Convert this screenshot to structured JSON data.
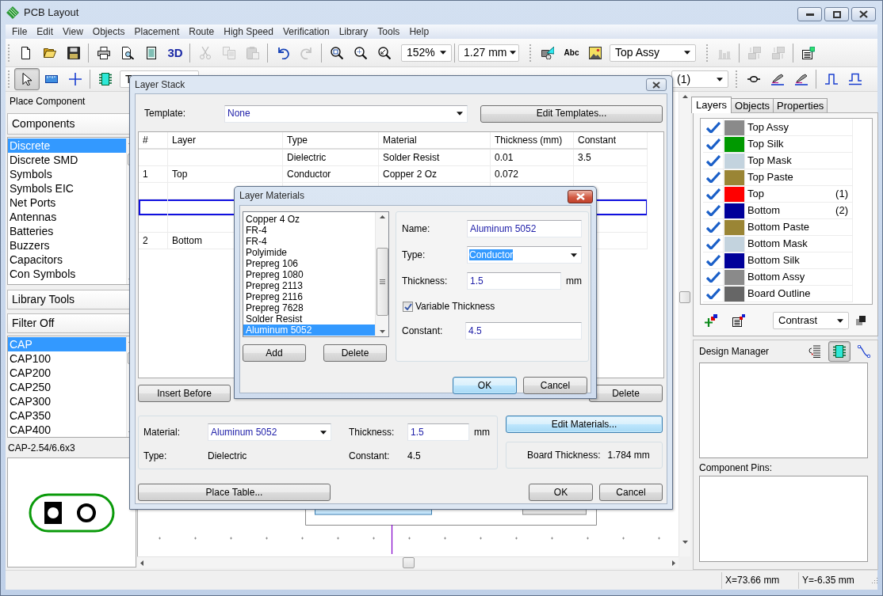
{
  "window": {
    "title": "PCB Layout"
  },
  "menu": [
    "File",
    "Edit",
    "View",
    "Objects",
    "Placement",
    "Route",
    "High Speed",
    "Verification",
    "Library",
    "Tools",
    "Help"
  ],
  "toolbar_row_1": [
    {
      "groups": [
        [
          {
            "kind": "button",
            "disabled": false
          },
          {
            "kind": "button",
            "disabled": false
          },
          {
            "kind": "button",
            "disabled": false
          }
        ],
        [
          {
            "kind": "button",
            "disabled": false
          },
          {
            "kind": "button",
            "disabled": false
          },
          {
            "kind": "button",
            "disabled": false
          },
          {
            "kind": "text_button",
            "label": "3D",
            "disabled": false
          }
        ],
        [
          {
            "kind": "button",
            "disabled": true
          },
          {
            "kind": "button",
            "disabled": true
          },
          {
            "kind": "button",
            "disabled": true
          }
        ],
        [
          {
            "kind": "button",
            "disabled": false
          },
          {
            "kind": "button",
            "disabled": true
          }
        ],
        [
          {
            "kind": "button",
            "disabled": false
          },
          {
            "kind": "button",
            "disabled": false
          },
          {
            "kind": "button",
            "disabled": false
          },
          {
            "kind": "combo",
            "value": "152%"
          }
        ],
        [
          {
            "kind": "combo",
            "value": "1.27 mm"
          }
        ]
      ]
    },
    {
      "groups": [
        [
          {
            "kind": "button",
            "disabled": false
          },
          {
            "kind": "text_button",
            "label": "Abc",
            "disabled": false
          },
          {
            "kind": "button",
            "disabled": false
          },
          {
            "kind": "combo",
            "value": "Top Assy"
          }
        ]
      ]
    },
    {
      "groups": [
        [
          {
            "kind": "button",
            "disabled": true
          }
        ],
        [
          {
            "kind": "button",
            "disabled": true
          },
          {
            "kind": "button",
            "disabled": true
          }
        ],
        [
          {
            "kind": "button",
            "disabled": false
          }
        ]
      ]
    }
  ],
  "toolbar_row_2": [
    {
      "groups": [
        [
          {
            "kind": "button",
            "pressed": true
          },
          {
            "kind": "button",
            "pressed": false
          },
          {
            "kind": "button",
            "pressed": false
          }
        ],
        [
          {
            "kind": "button",
            "pressed": false
          },
          {
            "kind": "combo",
            "value": "T"
          }
        ]
      ]
    },
    {
      "groups": [
        [
          {
            "kind": "combo",
            "value": "(1)"
          }
        ]
      ]
    },
    {
      "groups": [
        [
          {
            "kind": "button",
            "pressed": false
          },
          {
            "kind": "button",
            "pressed": false
          },
          {
            "kind": "button",
            "pressed": false
          }
        ],
        [
          {
            "kind": "button",
            "pressed": false
          },
          {
            "kind": "button",
            "pressed": false
          }
        ]
      ]
    }
  ],
  "place_component": {
    "title": "Place Component",
    "components_button": "Components",
    "categories": [
      {
        "label": "Discrete",
        "selected": true
      },
      {
        "label": "Discrete SMD",
        "selected": false
      },
      {
        "label": "Symbols",
        "selected": false
      },
      {
        "label": "Symbols EIC",
        "selected": false
      },
      {
        "label": "Net Ports",
        "selected": false
      },
      {
        "label": "Antennas",
        "selected": false
      },
      {
        "label": "Batteries",
        "selected": false
      },
      {
        "label": "Buzzers",
        "selected": false
      },
      {
        "label": "Capacitors",
        "selected": false
      },
      {
        "label": "Con Symbols",
        "selected": false
      }
    ],
    "library_tools_button": "Library Tools",
    "filter_button": "Filter Off",
    "parts": [
      {
        "label": "CAP",
        "selected": true
      },
      {
        "label": "CAP100",
        "selected": false
      },
      {
        "label": "CAP200",
        "selected": false
      },
      {
        "label": "CAP250",
        "selected": false
      },
      {
        "label": "CAP300",
        "selected": false
      },
      {
        "label": "CAP350",
        "selected": false
      },
      {
        "label": "CAP400",
        "selected": false
      }
    ],
    "footprint": "CAP-2.54/6.6x3"
  },
  "layers_panel": {
    "tabs": [
      {
        "label": "Layers",
        "selected": true
      },
      {
        "label": "Objects",
        "selected": false
      },
      {
        "label": "Properties",
        "selected": false
      }
    ],
    "layers": [
      {
        "name": "Top Assy",
        "visible": true,
        "color": "#8a8a8a"
      },
      {
        "name": "Top Silk",
        "visible": true,
        "color": "#009900"
      },
      {
        "name": "Top Mask",
        "visible": true,
        "color": "#c3d3de"
      },
      {
        "name": "Top Paste",
        "visible": true,
        "color": "#9a8535"
      },
      {
        "name": "Top",
        "number": "(1)",
        "visible": true,
        "color": "#ff0000"
      },
      {
        "name": "Bottom",
        "number": "(2)",
        "visible": true,
        "color": "#00009a"
      },
      {
        "name": "Bottom Paste",
        "visible": true,
        "color": "#9a8535"
      },
      {
        "name": "Bottom Mask",
        "visible": true,
        "color": "#c3d3de"
      },
      {
        "name": "Bottom Silk",
        "visible": true,
        "color": "#00009a"
      },
      {
        "name": "Bottom Assy",
        "visible": true,
        "color": "#8a8a8a"
      },
      {
        "name": "Board Outline",
        "visible": true,
        "color": "#666666"
      }
    ],
    "display_mode": "Contrast"
  },
  "design_manager": {
    "title": "Design Manager",
    "views": [
      {
        "pressed": false
      },
      {
        "pressed": true
      },
      {
        "pressed": false
      }
    ],
    "pins_label": "Component Pins:"
  },
  "status_bar": {
    "x": "X=73.66 mm",
    "y": "Y=-6.35 mm"
  },
  "layer_stack": {
    "title": "Layer Stack",
    "template_label": "Template:",
    "template": "None",
    "edit_templates_button": "Edit Templates...",
    "table": {
      "columns": [
        "#",
        "Layer",
        "Type",
        "Material",
        "Thickness (mm)",
        "Constant"
      ],
      "rows": [
        {
          "selected": false,
          "type": "Dielectric",
          "material": "Solder Resist",
          "thickness": "0.01",
          "constant": "3.5"
        },
        {
          "selected": false,
          "number": "1",
          "layer": "Top",
          "type": "Conductor",
          "material": "Copper 2 Oz",
          "thickness": "0.072"
        },
        {
          "selected": false
        },
        {
          "selected": true
        },
        {
          "selected": false
        },
        {
          "selected": false,
          "number": "2",
          "layer": "Bottom"
        }
      ]
    },
    "insert_before_button": "Insert Before",
    "delete_button": "Delete",
    "material_label": "Material:",
    "material": "Aluminum 5052",
    "thickness_label": "Thickness:",
    "thickness": "1.5",
    "thickness_unit": "mm",
    "type_label": "Type:",
    "type": "Dielectric",
    "constant_label": "Constant:",
    "constant": "4.5",
    "edit_materials_button": {
      "label": "Edit Materials...",
      "focused": true
    },
    "board_thickness_label": "Board Thickness:",
    "board_thickness": "1.784 mm",
    "buttons": [
      {
        "label": "Place Table...",
        "focused": false
      },
      {
        "label": "OK",
        "focused": false
      },
      {
        "label": "Cancel",
        "focused": false
      }
    ]
  },
  "layer_materials": {
    "title": "Layer Materials",
    "materials": [
      {
        "label": "Copper 4 Oz",
        "selected": false
      },
      {
        "label": "FR-4",
        "selected": false
      },
      {
        "label": "FR-4",
        "selected": false
      },
      {
        "label": "Polyimide",
        "selected": false
      },
      {
        "label": "Prepreg 106",
        "selected": false
      },
      {
        "label": "Prepreg 1080",
        "selected": false
      },
      {
        "label": "Prepreg 2113",
        "selected": false
      },
      {
        "label": "Prepreg 2116",
        "selected": false
      },
      {
        "label": "Prepreg 7628",
        "selected": false
      },
      {
        "label": "Solder Resist",
        "selected": false
      },
      {
        "label": "Aluminum 5052",
        "selected": true
      }
    ],
    "add_button": "Add",
    "delete_button": "Delete",
    "name_label": "Name:",
    "name": "Aluminum 5052",
    "type_label": "Type:",
    "type": {
      "value": "Conductor",
      "highlighted": true
    },
    "thickness_label": "Thickness:",
    "thickness": "1.5",
    "thickness_unit": "mm",
    "variable_thickness": {
      "label": "Variable Thickness",
      "checked": true
    },
    "constant_label": "Constant:",
    "constant": "4.5",
    "buttons": [
      {
        "label": "OK",
        "focused": true
      },
      {
        "label": "Cancel",
        "focused": false
      }
    ]
  }
}
